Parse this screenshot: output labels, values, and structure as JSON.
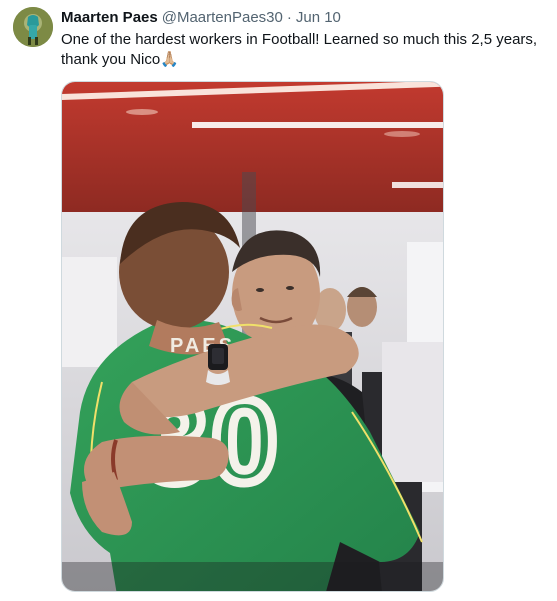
{
  "tweet": {
    "author_name": "Maarten Paes",
    "handle": "@MaartenPaes30",
    "separator": "·",
    "date": "Jun 10",
    "text": "One of the hardest workers in Football! Learned so much this 2,5 years, thank you Nico🙏🏼"
  },
  "media": {
    "jersey_number": "30",
    "jersey_name_partial": "PAES"
  },
  "colors": {
    "jersey_green": "#2f9a52",
    "ceiling_red": "#b8322a",
    "handle_gray": "#536471"
  },
  "icons": {
    "avatar": "avatar-image",
    "photo": "photo-image"
  }
}
